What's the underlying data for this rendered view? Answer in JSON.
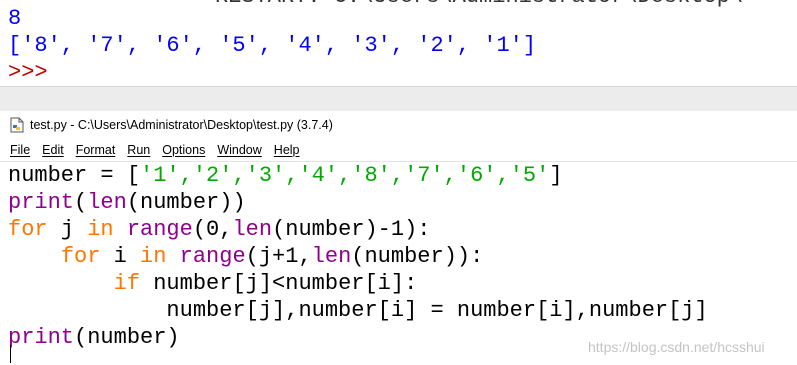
{
  "shell": {
    "cut_text": "RESTART: C:\\Users\\Administrator\\Desktop\\",
    "line1": "8",
    "line2": "['8', '7', '6', '5', '4', '3', '2', '1']",
    "prompt": ">>>"
  },
  "editor": {
    "title": "test.py - C:\\Users\\Administrator\\Desktop\\test.py (3.7.4)",
    "file_icon": "python-file-icon",
    "menu": [
      "File",
      "Edit",
      "Format",
      "Run",
      "Options",
      "Window",
      "Help"
    ],
    "code": {
      "l1": {
        "a": "number = [",
        "s": "'1','2','3','4','8','7','6','5'",
        "b": "]"
      },
      "l2": {
        "f": "print",
        "a": "(",
        "f2": "len",
        "b": "(number))"
      },
      "l3": {
        "k": "for",
        "a": " j ",
        "k2": "in",
        "sp": " ",
        "f": "range",
        "b": "(0,",
        "f2": "len",
        "c": "(number)-1):"
      },
      "l4": {
        "indent": "    ",
        "k": "for",
        "a": " i ",
        "k2": "in",
        "sp": " ",
        "f": "range",
        "b": "(j+1,",
        "f2": "len",
        "c": "(number)):"
      },
      "l5": {
        "indent": "        ",
        "k": "if",
        "a": " number[j]<number[i]:"
      },
      "l6": {
        "text": "            number[j],number[i] = number[i],number[j]"
      },
      "l7": {
        "f": "print",
        "a": "(number)"
      }
    }
  },
  "watermark": "https://blog.csdn.net/hcsshui",
  "colors": {
    "keyword": "#ff7700",
    "builtin": "#900090",
    "string": "#00aa00",
    "shell_output": "#0000ff",
    "prompt": "#c20000"
  }
}
